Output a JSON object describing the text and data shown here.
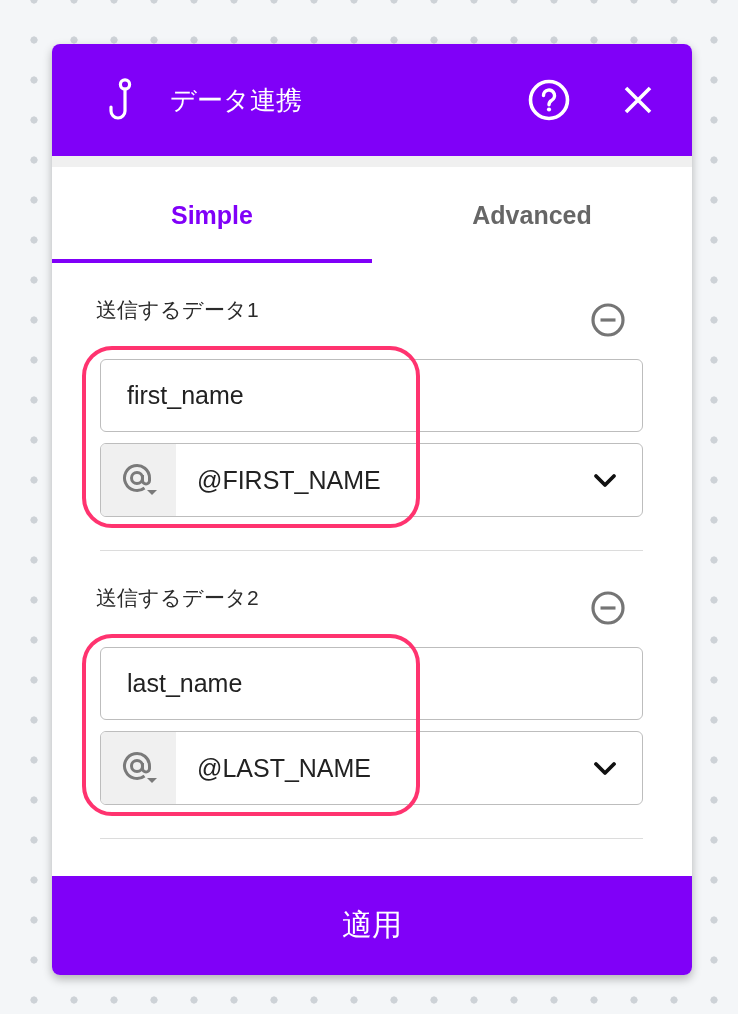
{
  "dialog": {
    "title": "データ連携"
  },
  "tabs": [
    {
      "label": "Simple",
      "selected": true
    },
    {
      "label": "Advanced",
      "selected": false
    }
  ],
  "entries": [
    {
      "label": "送信するデータ1",
      "key": "first_name",
      "variable": "@FIRST_NAME",
      "highlighted": true
    },
    {
      "label": "送信するデータ2",
      "key": "last_name",
      "variable": "@LAST_NAME",
      "highlighted": true
    }
  ],
  "apply_button": {
    "label": "適用"
  }
}
